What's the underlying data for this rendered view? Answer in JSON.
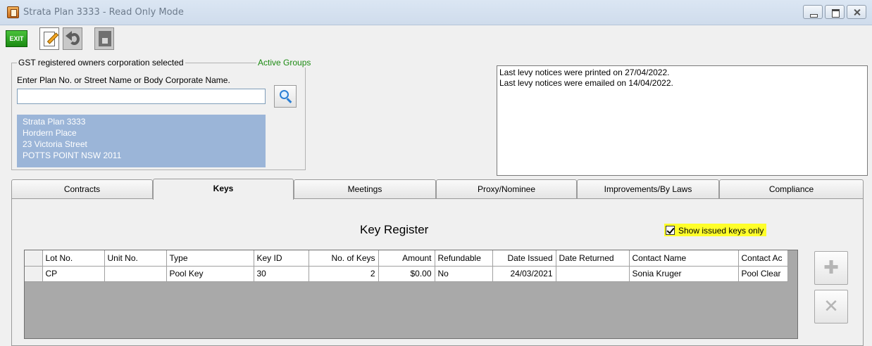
{
  "window": {
    "title": "Strata Plan 3333 - Read Only Mode"
  },
  "toolbar": {
    "exit_label": "EXIT"
  },
  "group": {
    "legend": "GST registered owners corporation selected",
    "active_groups": "Active Groups",
    "search_label": "Enter Plan No. or Street Name or Body Corporate Name.",
    "search_value": "",
    "address_lines": [
      "Strata Plan 3333",
      "Hordern Place",
      "23 Victoria Street",
      "POTTS POINT  NSW  2011"
    ]
  },
  "notes": {
    "lines": [
      "Last levy notices were printed on 27/04/2022.",
      "Last levy notices were emailed on 14/04/2022."
    ]
  },
  "tabs": [
    "Contracts",
    "Keys",
    "Meetings",
    "Proxy/Nominee",
    "Improvements/By Laws",
    "Compliance"
  ],
  "active_tab": "Keys",
  "key_register": {
    "title": "Key Register",
    "show_issued_label": "Show issued keys only",
    "show_issued_checked": true,
    "columns": [
      "Lot No.",
      "Unit No.",
      "Type",
      "Key ID",
      "No. of Keys",
      "Amount",
      "Refundable",
      "Date Issued",
      "Date Returned",
      "Contact Name",
      "Contact Ac"
    ],
    "rows": [
      [
        "CP",
        "",
        "Pool Key",
        "30",
        "2",
        "$0.00",
        "No",
        "24/03/2021",
        "",
        "Sonia Kruger",
        "Pool Clear"
      ]
    ]
  },
  "icons": {
    "add": "add-icon",
    "delete": "delete-icon"
  }
}
